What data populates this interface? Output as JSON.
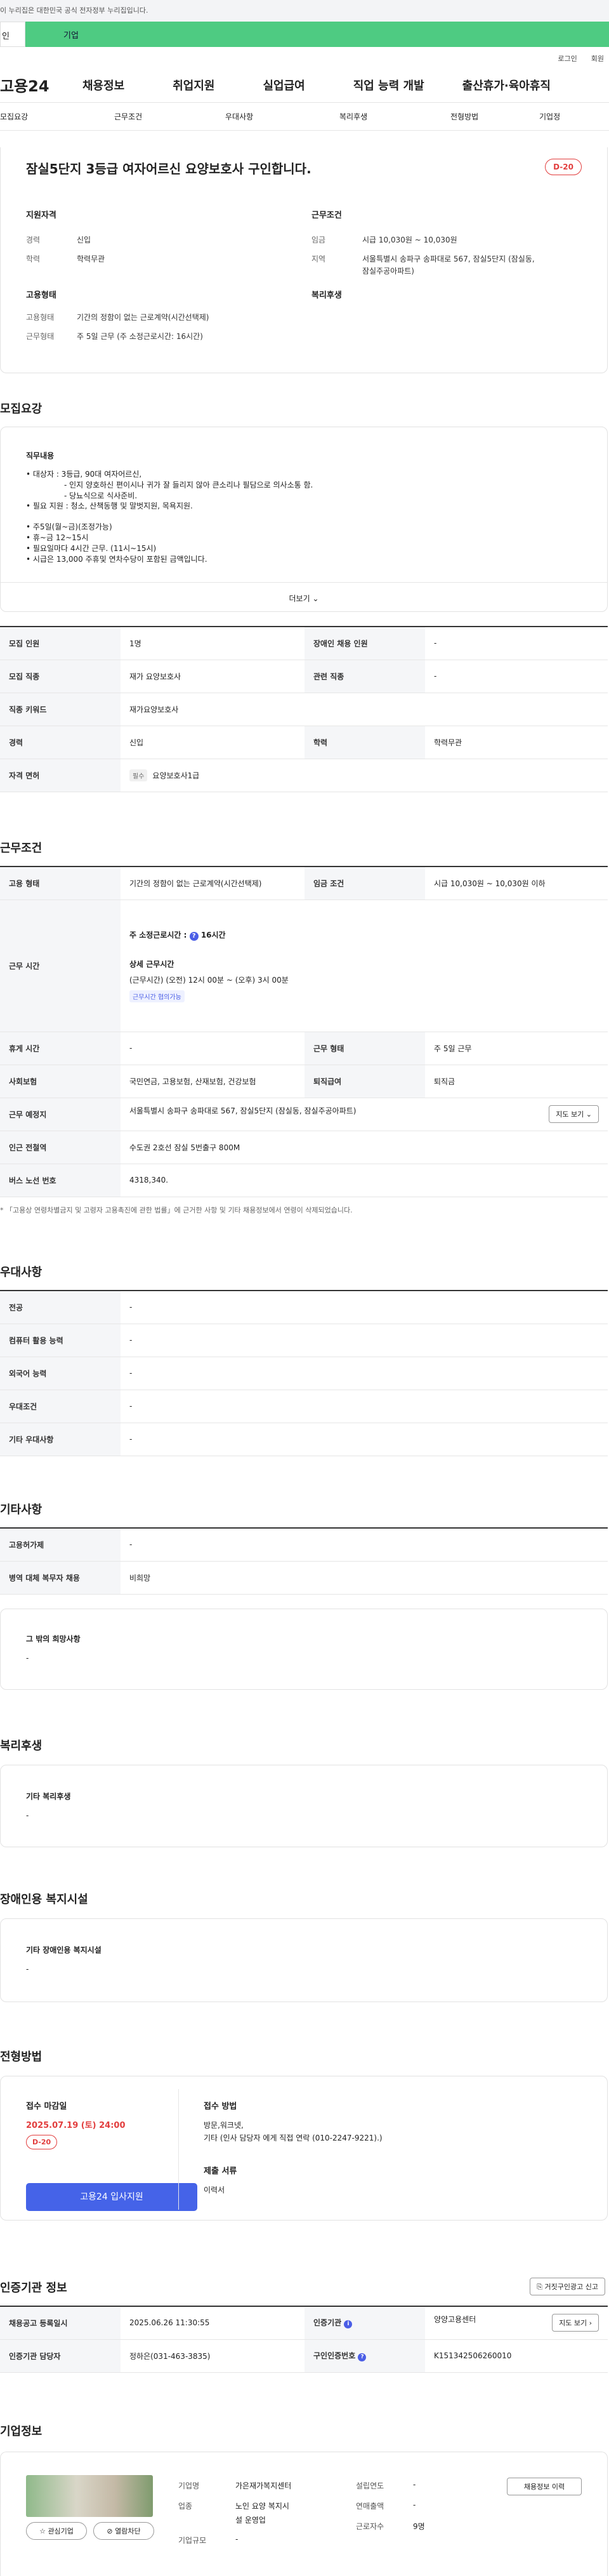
{
  "gov_banner": "이 누리집은 대한민국 공식 전자정부 누리집입니다.",
  "tabs": {
    "left": "인",
    "right": "기업"
  },
  "util": {
    "login": "로그인",
    "join": "회원"
  },
  "gnb": {
    "logo": "고용24",
    "items": [
      "채용정보",
      "취업지원",
      "실업급여",
      "직업 능력 개발",
      "출산휴가·육아휴직"
    ]
  },
  "subnav": [
    "모집요강",
    "근무조건",
    "우대사항",
    "복리후생",
    "전형방법",
    "기업정"
  ],
  "header": {
    "title": "잠실5단지 3등급 여자어르신 요양보호사 구인합니다.",
    "dday": "D-20",
    "qual_title": "지원자격",
    "qual": [
      {
        "k": "경력",
        "v": "신입"
      },
      {
        "k": "학력",
        "v": "학력무관"
      }
    ],
    "cond_title": "근무조건",
    "cond": [
      {
        "k": "임금",
        "v": "시급 10,030원 ~ 10,030원"
      },
      {
        "k": "지역",
        "v": "서울특별시 송파구 송파대로 567, 잠실5단지 (잠실동,"
      },
      {
        "k": "",
        "v": "잠실주공아파트)"
      }
    ],
    "emp_title": "고용형태",
    "emp": [
      {
        "k": "고용형태",
        "v": "기간의 정함이 없는 근로계약(시간선택제)"
      },
      {
        "k": "근무형태",
        "v": "주 5일 근무 (주 소정근로시간: 16시간)"
      }
    ],
    "welfare_title": "복리후생"
  },
  "recruit": {
    "section": "모집요강",
    "duty_title": "직무내용",
    "duty_lines": [
      "• 대상자 : 3등급, 90대 여자어르신,",
      "- 인지 양호하신 편이시나 귀가 잘 들리지 않아 큰소리나 필담으로 의사소통 함.",
      "- 당뇨식으로 식사준비.",
      "• 필요 지원 : 청소, 산책동행 및 말벗지원, 목욕지원.",
      "",
      "• 주5일(월~금)(조정가능)",
      "• 휴~금 12~15시",
      "• 필요일마다 4시간 근무. (11시~15시)",
      "• 시급은 13,000 주휴및 연차수당이 포함된 금액입니다."
    ],
    "more": "더보기",
    "table": [
      {
        "h1": "모집 인원",
        "v1": "1명",
        "h2": "장애인 채용 인원",
        "v2": "-"
      },
      {
        "h1": "모집 직종",
        "v1": "재가 요양보호사",
        "h2": "관련 직종",
        "v2": "-"
      },
      {
        "h1": "직종 키워드",
        "v1": "재가요양보호사"
      },
      {
        "h1": "경력",
        "v1": "신입",
        "h2": "학력",
        "v2": "학력무관"
      },
      {
        "h1": "자격 면허",
        "tag": "필수",
        "v1": "요양보호사1급"
      }
    ]
  },
  "work": {
    "section": "근무조건",
    "emp_type_h": "고용 형태",
    "emp_type_v": "기간의 정함이 없는 근로계약(시간선택제)",
    "wage_h": "임금 조건",
    "wage_v": "시급 10,030원 ~ 10,030원 이하",
    "hours_h": "근무 시간",
    "weekly": "주 소정근로시간 :",
    "weekly_v": "16시간",
    "detail_title": "상세 근무시간",
    "detail_v": "(근무시간) (오전) 12시 00분 ~ (오후) 3시 00분",
    "detail_tag": "근무시간 협의가능",
    "rest_h": "휴게 시간",
    "rest_v": "-",
    "shape_h": "근무 형태",
    "shape_v": "주 5일 근무",
    "ins_h": "사회보험",
    "ins_v": "국민연금, 고용보험, 산재보험, 건강보험",
    "ret_h": "퇴직급여",
    "ret_v": "퇴직금",
    "place_h": "근무 예정지",
    "place_v": "서울특별시 송파구 송파대로 567, 잠실5단지 (잠실동, 잠실주공아파트)",
    "map": "지도 보기",
    "subway_h": "인근 전철역",
    "subway_v": "수도권 2호선 잠실 5번출구 800M",
    "bus_h": "버스 노선 번호",
    "bus_v": "4318,340.",
    "note": "* 「고용상 연령차별금지 및 고령자 고용촉진에 관한 법률」에 근거한 사항 및 기타 채용정보에서 연령이 삭제되었습니다."
  },
  "pref": {
    "section": "우대사항",
    "rows": [
      {
        "h": "전공",
        "v": "-"
      },
      {
        "h": "컴퓨터 활용 능력",
        "v": "-"
      },
      {
        "h": "외국어 능력",
        "v": "-"
      },
      {
        "h": "우대조건",
        "v": "-"
      },
      {
        "h": "기타 우대사항",
        "v": "-"
      }
    ]
  },
  "etc": {
    "section": "기타사항",
    "rows": [
      {
        "h": "고용허가제",
        "v": "-"
      },
      {
        "h": "병역 대체 복무자 채용",
        "v": "비희망"
      }
    ],
    "other_title": "그 밖의 희망사항",
    "other_v": "-"
  },
  "welfare": {
    "section": "복리후생",
    "title": "기타 복리후생",
    "v": "-"
  },
  "disabled": {
    "section": "장애인용 복지시설",
    "title": "기타 장애인용 복지시설",
    "v": "-"
  },
  "select": {
    "section": "전형방법",
    "deadline_t": "접수 마감일",
    "deadline_v": "2025.07.19 (토) 24:00",
    "dday": "D-20",
    "apply_btn": "고용24 입사지원",
    "method_t": "접수 방법",
    "method_v1": "방문,워크넷,",
    "method_v2": "기타 (인사 담당자 에게 직접 연락 (010-2247-9221).)",
    "docs_t": "제출 서류",
    "docs_v": "이력서"
  },
  "cert": {
    "section": "인증기관 정보",
    "report": "거짓구인광고 신고",
    "reg_h": "채용공고 등록일시",
    "reg_v": "2025.06.26 11:30:55",
    "org_h": "인증기관",
    "org_v": "양양고용센터",
    "map": "지도 보기",
    "mgr_h": "인증기관 담당자",
    "mgr_v": "정하은(031-463-3835)",
    "num_h": "구인인증번호",
    "num_v": "K151342506260010"
  },
  "company": {
    "section": "기업정보",
    "fav": "관심기업",
    "block": "열람차단",
    "name_k": "기업명",
    "name_v": "가은재가복지센터",
    "biz_k": "업종",
    "biz_v1": "노인 요양 복지시",
    "biz_v2": "설 운영업",
    "scale_k": "기업규모",
    "scale_v": "-",
    "year_k": "설립연도",
    "year_v": "-",
    "sales_k": "연매출액",
    "sales_v": "-",
    "emp_k": "근로자수",
    "emp_v": "9명",
    "jobs_btn": "채용정보 이력"
  }
}
